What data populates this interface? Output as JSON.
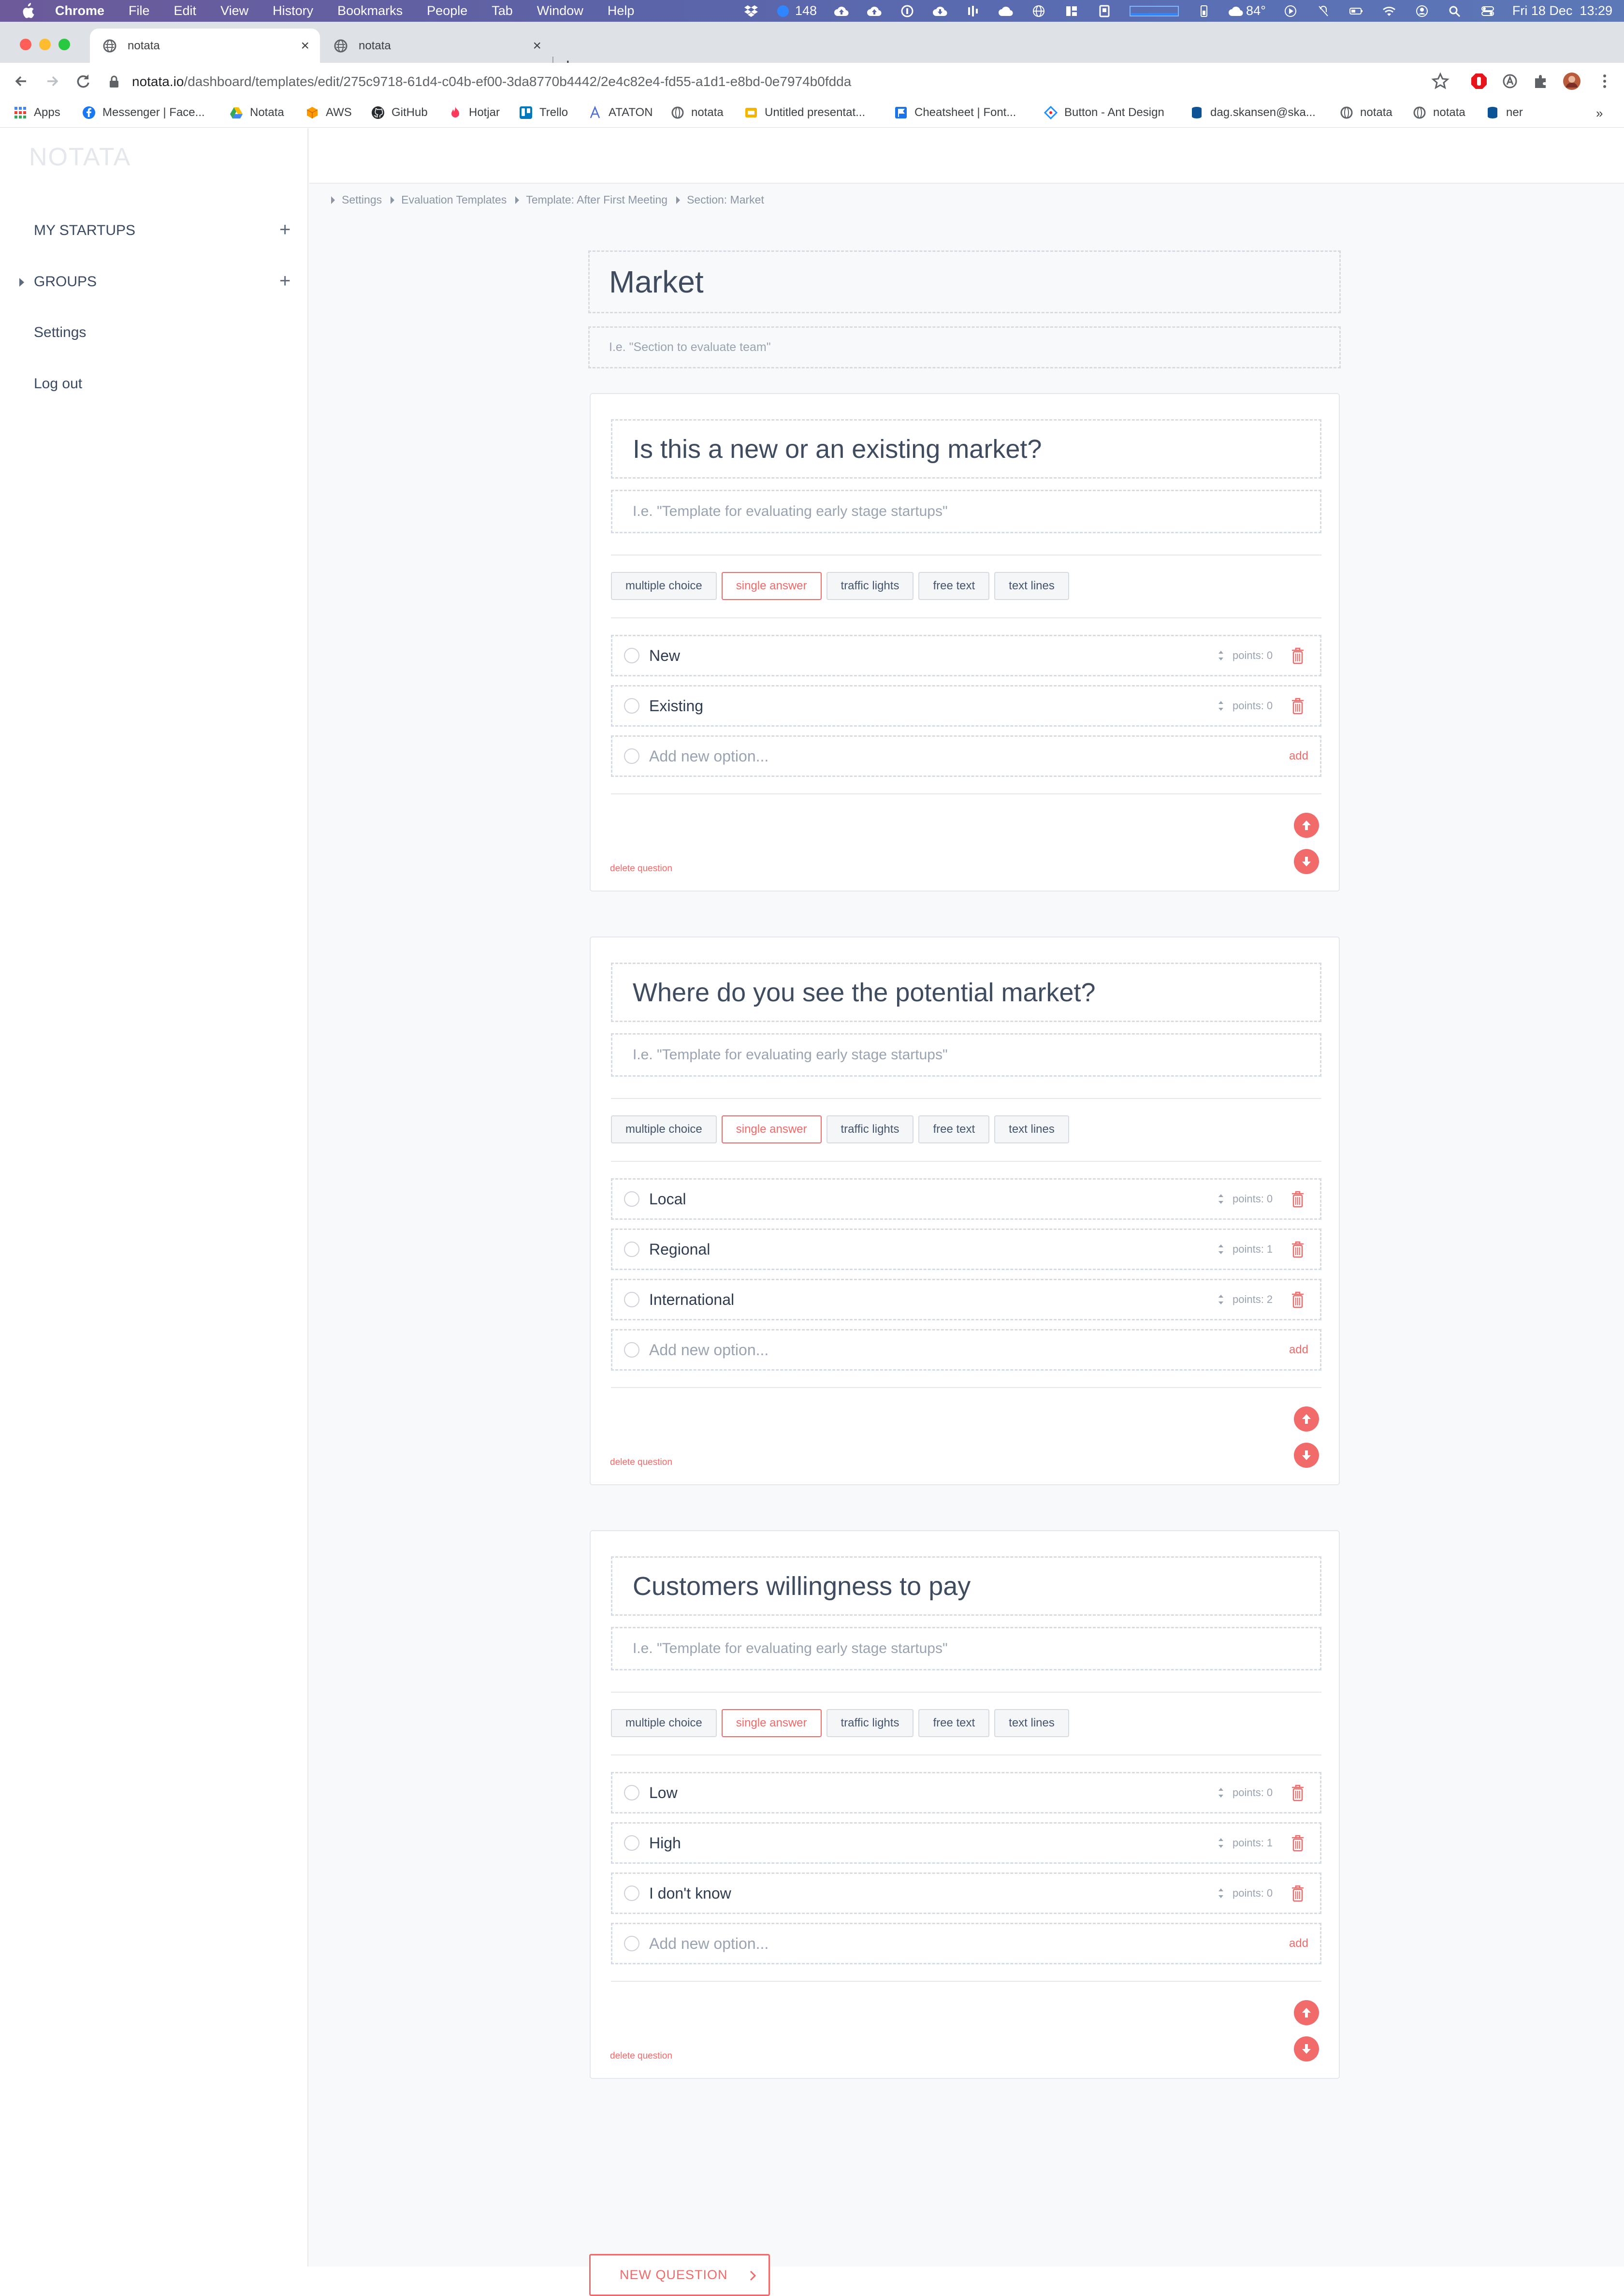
{
  "menubar": {
    "app": "Chrome",
    "menus": [
      "File",
      "Edit",
      "View",
      "History",
      "Bookmarks",
      "People",
      "Tab",
      "Window",
      "Help"
    ],
    "badge_count": "148",
    "temperature": "84°",
    "datetime": "Fri 18 Dec  13:29"
  },
  "tabs": [
    {
      "title": "notata",
      "active": true
    },
    {
      "title": "notata",
      "active": false
    }
  ],
  "omnibox": {
    "host": "notata.io",
    "path": "/dashboard/templates/edit/275c9718-61d4-c04b-ef00-3da8770b4442/2e4c82e4-fd55-a1d1-e8bd-0e7974b0fdda"
  },
  "bookmarks": [
    {
      "label": "Apps",
      "icon": "apps-grid-icon",
      "color": "#4285f4"
    },
    {
      "label": "Messenger | Face...",
      "icon": "facebook-icon",
      "color": "#1877f2"
    },
    {
      "label": "Notata",
      "icon": "google-drive-icon",
      "color": "#34a853"
    },
    {
      "label": "AWS",
      "icon": "aws-cube-icon",
      "color": "#ff9900"
    },
    {
      "label": "GitHub",
      "icon": "github-icon",
      "color": "#24292e"
    },
    {
      "label": "Hotjar",
      "icon": "hotjar-flame-icon",
      "color": "#fd3a5c"
    },
    {
      "label": "Trello",
      "icon": "trello-icon",
      "color": "#0079bf"
    },
    {
      "label": "ATATON",
      "icon": "ataton-icon",
      "color": "#4a6cd4"
    },
    {
      "label": "notata",
      "icon": "globe-icon",
      "color": "#5f6368"
    },
    {
      "label": "Untitled presentat...",
      "icon": "slides-icon",
      "color": "#f4b400"
    },
    {
      "label": "Cheatsheet | Font...",
      "icon": "flag-icon",
      "color": "#1a73e8"
    },
    {
      "label": "Button - Ant Design",
      "icon": "ant-design-icon",
      "color": "#1890ff"
    },
    {
      "label": "dag.skansen@ska...",
      "icon": "database-icon",
      "color": "#0b5394"
    },
    {
      "label": "notata",
      "icon": "globe-icon",
      "color": "#5f6368"
    },
    {
      "label": "notata",
      "icon": "globe-icon",
      "color": "#5f6368"
    },
    {
      "label": "ner",
      "icon": "database-icon",
      "color": "#0b5394"
    }
  ],
  "app": {
    "logo": "NOTATA",
    "sidebar": {
      "my_startups": "MY STARTUPS",
      "groups": "GROUPS",
      "settings": "Settings",
      "logout": "Log out"
    },
    "breadcrumb": [
      "Settings",
      "Evaluation Templates",
      "Template: After First Meeting",
      "Section: Market"
    ]
  },
  "section": {
    "title": "Market",
    "description_placeholder": "I.e. \"Section to evaluate team\""
  },
  "question_types": [
    "multiple choice",
    "single answer",
    "traffic lights",
    "free text",
    "text lines"
  ],
  "questions": [
    {
      "title": "Is this a new or an existing market?",
      "description_placeholder": "I.e. \"Template for evaluating early stage startups\"",
      "selected_type": "single answer",
      "options": [
        {
          "label": "New",
          "points": "points: 0"
        },
        {
          "label": "Existing",
          "points": "points: 0"
        }
      ],
      "add_placeholder": "Add new option...",
      "add_label": "add",
      "delete_label": "delete question"
    },
    {
      "title": "Where do you see the potential market?",
      "description_placeholder": "I.e. \"Template for evaluating early stage startups\"",
      "selected_type": "single answer",
      "options": [
        {
          "label": "Local",
          "points": "points: 0"
        },
        {
          "label": "Regional",
          "points": "points: 1"
        },
        {
          "label": "International",
          "points": "points: 2"
        }
      ],
      "add_placeholder": "Add new option...",
      "add_label": "add",
      "delete_label": "delete question"
    },
    {
      "title": "Customers willingness to pay",
      "description_placeholder": "I.e. \"Template for evaluating early stage startups\"",
      "selected_type": "single answer",
      "options": [
        {
          "label": "Low",
          "points": "points: 0"
        },
        {
          "label": "High",
          "points": "points: 1"
        },
        {
          "label": "I don't know",
          "points": "points: 0"
        }
      ],
      "add_placeholder": "Add new option...",
      "add_label": "add",
      "delete_label": "delete question"
    }
  ],
  "new_question_label": "NEW QUESTION",
  "colors": {
    "accent": "#f16a6a",
    "text": "#3f4b5e",
    "muted": "#9aa3b0"
  }
}
